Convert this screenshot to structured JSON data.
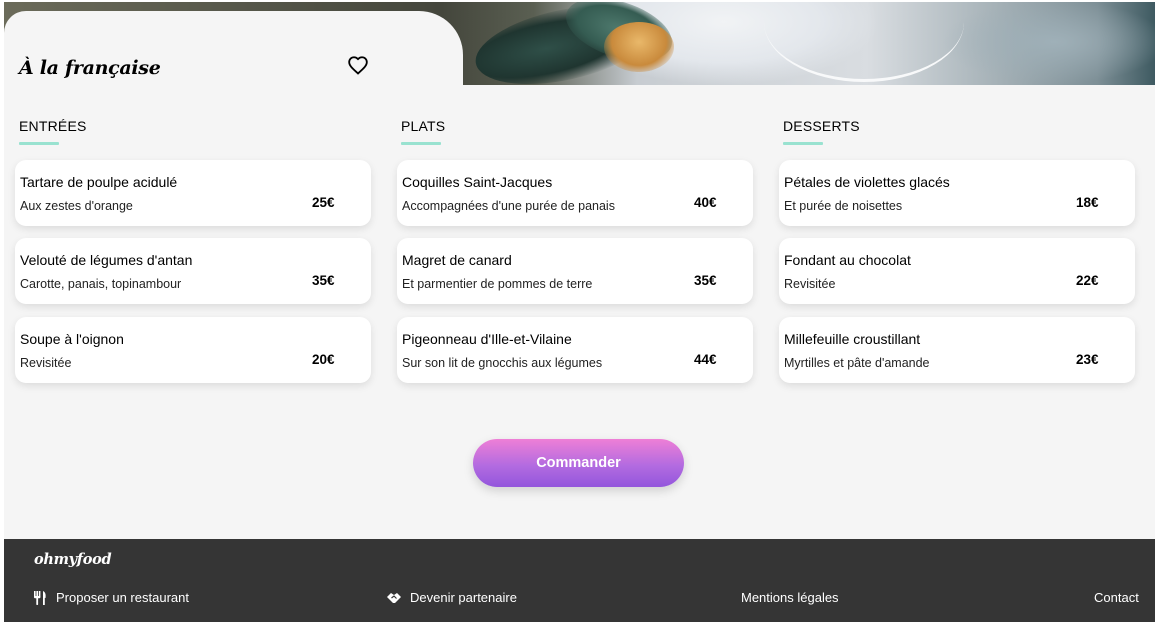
{
  "restaurant": {
    "name": "À la française"
  },
  "icons": {
    "favorite": "heart-outline-icon",
    "propose": "utensils-icon",
    "partner": "handshake-icon"
  },
  "colors": {
    "accent_underline": "#99e2d0",
    "button_gradient_top": "#ee7fd6",
    "button_gradient_bottom": "#9356dc",
    "footer_bg": "#353535",
    "page_bg": "#f5f5f5"
  },
  "menu": [
    {
      "heading": "ENTRÉES",
      "items": [
        {
          "name": "Tartare de poulpe acidulé",
          "description": "Aux zestes d'orange",
          "price": "25€"
        },
        {
          "name": "Velouté de légumes d'antan",
          "description": "Carotte, panais, topinambour",
          "price": "35€"
        },
        {
          "name": "Soupe à l'oignon",
          "description": "Revisitée",
          "price": "20€"
        }
      ]
    },
    {
      "heading": "PLATS",
      "items": [
        {
          "name": "Coquilles Saint-Jacques",
          "description": "Accompagnées d'une purée de panais",
          "price": "40€"
        },
        {
          "name": "Magret de canard",
          "description": "Et parmentier de pommes de terre",
          "price": "35€"
        },
        {
          "name": "Pigeonneau d'Ille-et-Vilaine",
          "description": "Sur son lit de gnocchis aux légumes",
          "price": "44€"
        }
      ]
    },
    {
      "heading": "DESSERTS",
      "items": [
        {
          "name": "Pétales de violettes glacés",
          "description": "Et purée de noisettes",
          "price": "18€"
        },
        {
          "name": "Fondant au chocolat",
          "description": "Revisitée",
          "price": "22€"
        },
        {
          "name": "Millefeuille croustillant",
          "description": "Myrtilles et pâte d'amande",
          "price": "23€"
        }
      ]
    }
  ],
  "order_button": {
    "label": "Commander"
  },
  "footer": {
    "logo": "ohmyfood",
    "links": {
      "propose": "Proposer un restaurant",
      "partner": "Devenir partenaire",
      "legal": "Mentions légales",
      "contact": "Contact"
    }
  }
}
